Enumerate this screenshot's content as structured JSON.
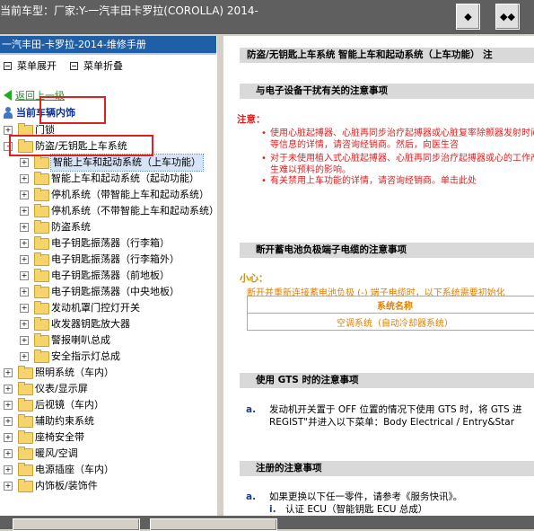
{
  "window": {
    "title": "当前车型：厂家:Y-一汽丰田卡罗拉(COROLLA) 2014-"
  },
  "toolbar": {
    "btn1_symbol": "◆",
    "btn2_symbol": "◆◆"
  },
  "left": {
    "header": "一汽丰田-卡罗拉-2014-维修手册",
    "expand_all": "菜单展开",
    "collapse_all": "菜单折叠",
    "back_label": "返回上一级",
    "current_label": "当前车辆内饰",
    "tree": [
      {
        "label": "门锁",
        "level": 0,
        "toggle": "+"
      },
      {
        "label": "防盗/无钥匙上车系统",
        "level": 0,
        "toggle": "-"
      },
      {
        "label": "智能上车和起动系统（上车功能）",
        "level": 1,
        "toggle": "+",
        "selected": true
      },
      {
        "label": "智能上车和起动系统（起动功能）",
        "level": 1,
        "toggle": "+"
      },
      {
        "label": "停机系统（带智能上车和起动系统）",
        "level": 1,
        "toggle": "+"
      },
      {
        "label": "停机系统（不带智能上车和起动系统）",
        "level": 1,
        "toggle": "+"
      },
      {
        "label": "防盗系统",
        "level": 1,
        "toggle": "+"
      },
      {
        "label": "电子钥匙振荡器（行李箱）",
        "level": 1,
        "toggle": "+"
      },
      {
        "label": "电子钥匙振荡器（行李箱外）",
        "level": 1,
        "toggle": "+"
      },
      {
        "label": "电子钥匙振荡器（前地板）",
        "level": 1,
        "toggle": "+"
      },
      {
        "label": "电子钥匙振荡器（中央地板）",
        "level": 1,
        "toggle": "+"
      },
      {
        "label": "发动机罩门控灯开关",
        "level": 1,
        "toggle": "+"
      },
      {
        "label": "收发器钥匙放大器",
        "level": 1,
        "toggle": "+"
      },
      {
        "label": "警报喇叭总成",
        "level": 1,
        "toggle": "+"
      },
      {
        "label": "安全指示灯总成",
        "level": 1,
        "toggle": "+"
      },
      {
        "label": "照明系统（车内）",
        "level": 0,
        "toggle": "+"
      },
      {
        "label": "仪表/显示屏",
        "level": 0,
        "toggle": "+"
      },
      {
        "label": "后视镜（车内）",
        "level": 0,
        "toggle": "+"
      },
      {
        "label": "辅助约束系统",
        "level": 0,
        "toggle": "+"
      },
      {
        "label": "座椅安全带",
        "level": 0,
        "toggle": "+"
      },
      {
        "label": "暖风/空调",
        "level": 0,
        "toggle": "+"
      },
      {
        "label": "电源插座（车内）",
        "level": 0,
        "toggle": "+"
      },
      {
        "label": "内饰板/装饰件",
        "level": 0,
        "toggle": "+"
      }
    ]
  },
  "content": {
    "page_title": "防盗/无钥匙上车系统  智能上车和起动系统（上车功能）  注",
    "sec1_title": "与电子设备干扰有关的注意事项",
    "note_label": "注意：",
    "note_bullets": [
      "使用心脏起搏器、心脏再同步治疗起搏器或心脏复率除颤器发射时间等信息的详情，请咨询经销商。然后，向医生咨",
      "对于未使用植入式心脏起搏器、心脏再同步治疗起搏器或心的工作产生难以预料的影响。",
      "有关禁用上车功能的详情，请咨询经销商。单击此处"
    ],
    "sec2_title": "断开蓄电池负极端子电缆的注意事项",
    "caution_label": "小心：",
    "caution_text": "断开并重新连接蓄电池负极 (-) 端子电缆时，以下系统需要初始化",
    "table_header": "系统名称",
    "table_row": "空调系统（自动冷却器系统）",
    "sec3_title": "使用 GTS 时的注意事项",
    "gts_mark": "a.",
    "gts_line1": "发动机开关置于 OFF 位置的情况下使用 GTS 时，将 GTS 进",
    "gts_line2": "REGIST\"并进入以下菜单：Body Electrical / Entry&Star",
    "sec4_title": "注册的注意事项",
    "reg_mark": "a.",
    "reg_line1": "如果更换以下任一零件，请参考《服务快讯》。",
    "reg_sub_mark": "i.",
    "reg_sub_line": "认证 ECU（智能钥匙 ECU 总成）"
  },
  "colors": {
    "header_bg": "#1f5fa8",
    "annotation_red": "#e02020",
    "note_red": "#e02020",
    "caution_orange": "#e08000"
  }
}
